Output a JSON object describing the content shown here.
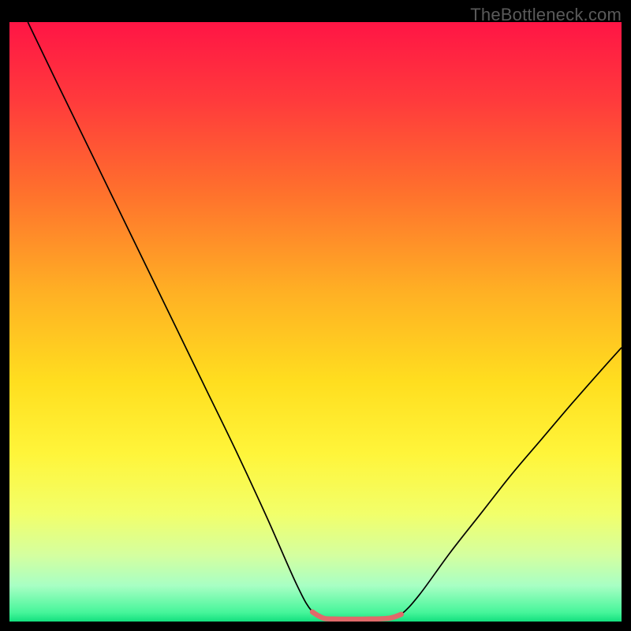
{
  "watermark": "TheBottleneck.com",
  "chart_data": {
    "type": "line",
    "title": "",
    "xlabel": "",
    "ylabel": "",
    "xlim": [
      0,
      100
    ],
    "ylim": [
      0,
      100
    ],
    "grid": false,
    "background_gradient": {
      "direction": "vertical",
      "stops": [
        {
          "pos": 0.0,
          "color": "#ff1545"
        },
        {
          "pos": 0.13,
          "color": "#ff3a3c"
        },
        {
          "pos": 0.28,
          "color": "#ff6f2d"
        },
        {
          "pos": 0.45,
          "color": "#ffb024"
        },
        {
          "pos": 0.6,
          "color": "#ffde1f"
        },
        {
          "pos": 0.72,
          "color": "#fff53a"
        },
        {
          "pos": 0.82,
          "color": "#f2ff6a"
        },
        {
          "pos": 0.89,
          "color": "#d4ffa0"
        },
        {
          "pos": 0.94,
          "color": "#a8ffc4"
        },
        {
          "pos": 0.985,
          "color": "#46f59a"
        },
        {
          "pos": 1.0,
          "color": "#13e07e"
        }
      ]
    },
    "series": [
      {
        "name": "bottleneck-curve",
        "color": "#000000",
        "width": 1.7,
        "x": [
          3.0,
          7,
          12,
          17,
          22,
          27,
          32,
          37,
          42,
          47,
          49.5,
          51.5,
          54,
          57,
          60,
          62,
          64,
          67,
          72,
          77,
          82,
          87,
          92,
          97,
          100
        ],
        "y": [
          100,
          91.5,
          81,
          70.5,
          60,
          49.5,
          39,
          28.5,
          17.5,
          6.0,
          1.6,
          0.5,
          0.4,
          0.4,
          0.45,
          0.55,
          1.2,
          4.5,
          11.5,
          18.0,
          24.5,
          30.5,
          36.5,
          42.3,
          45.7
        ]
      },
      {
        "name": "optimal-range-marker",
        "color": "#e06a6a",
        "width": 6.5,
        "cap": "round",
        "x": [
          49.5,
          50.5,
          51.5,
          53,
          54.5,
          56,
          57.5,
          59,
          60.5,
          62,
          63.0,
          64.0
        ],
        "y": [
          1.6,
          0.95,
          0.5,
          0.42,
          0.4,
          0.4,
          0.4,
          0.42,
          0.45,
          0.55,
          0.8,
          1.2
        ]
      }
    ]
  }
}
